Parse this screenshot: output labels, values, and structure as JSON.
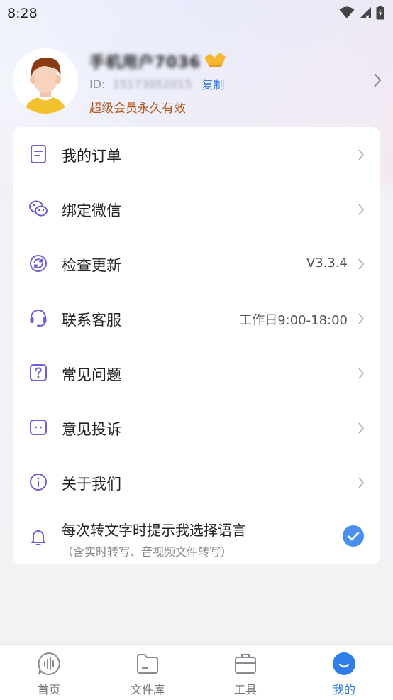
{
  "status_bar": {
    "time": "8:28"
  },
  "profile": {
    "name": "手机用户7036",
    "id_label": "ID:",
    "id_value": "15173052015",
    "copy_label": "复制",
    "vip_text": "超级会员永久有效"
  },
  "menu": {
    "items": [
      {
        "label": "我的订单",
        "value": "",
        "icon": "order-icon"
      },
      {
        "label": "绑定微信",
        "value": "",
        "icon": "wechat-icon"
      },
      {
        "label": "检查更新",
        "value": "V3.3.4",
        "icon": "refresh-icon"
      },
      {
        "label": "联系客服",
        "value": "工作日9:00-18:00",
        "icon": "headset-icon"
      },
      {
        "label": "常见问题",
        "value": "",
        "icon": "question-icon"
      },
      {
        "label": "意见投诉",
        "value": "",
        "icon": "feedback-icon"
      },
      {
        "label": "关于我们",
        "value": "",
        "icon": "info-icon"
      }
    ],
    "language_prompt": {
      "title": "每次转文字时提示我选择语言",
      "subtitle": "（含实时转写、音视频文件转写）",
      "checked": true
    }
  },
  "bottom_nav": {
    "items": [
      {
        "label": "首页",
        "icon": "audio-wave-icon",
        "active": false
      },
      {
        "label": "文件库",
        "icon": "folder-icon",
        "active": false
      },
      {
        "label": "工具",
        "icon": "toolbox-icon",
        "active": false
      },
      {
        "label": "我的",
        "icon": "smile-icon",
        "active": true
      }
    ]
  },
  "colors": {
    "accent": "#2f7de8",
    "icon_purple": "#6f5fd6",
    "vip_text": "#b5561a",
    "copy_link": "#3b82e6"
  }
}
